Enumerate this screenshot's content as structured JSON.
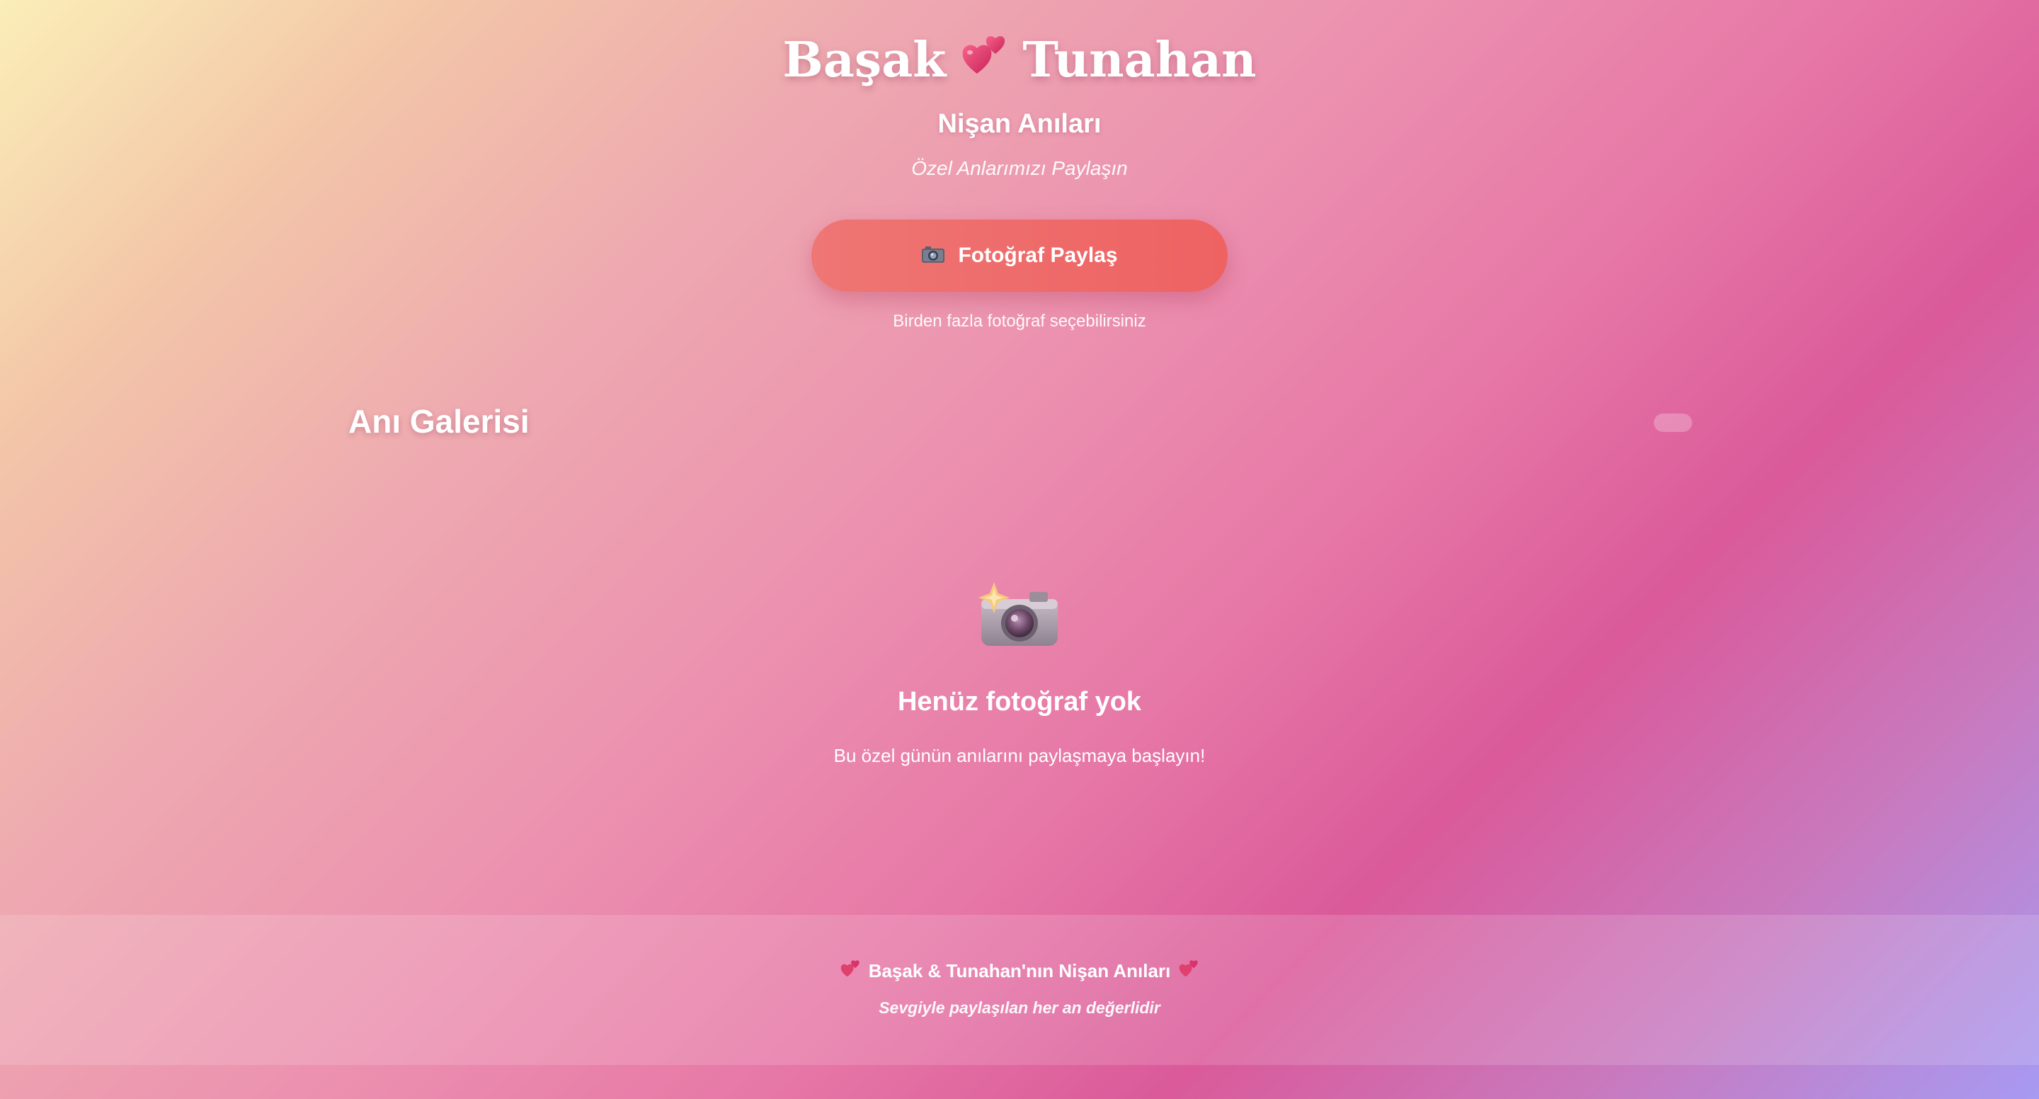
{
  "header": {
    "name_left": "Başak",
    "name_right": "Tunahan",
    "heart_icon": "two-hearts-icon",
    "subtitle": "Nişan Anıları",
    "tagline": "Özel Anlarımızı Paylaşın"
  },
  "upload": {
    "button_label": "Fotoğraf Paylaş",
    "button_icon": "camera-icon",
    "hint": "Birden fazla fotoğraf seçebilirsiniz"
  },
  "gallery": {
    "title": "Anı Galerisi",
    "empty_icon": "camera-with-flash-icon",
    "empty_title": "Henüz fotoğraf yok",
    "empty_description": "Bu özel günün anılarını paylaşmaya başlayın!"
  },
  "footer": {
    "main_text": "Başak & Tunahan'nın Nişan Anıları",
    "sub_text": "Sevgiyle paylaşılan her an değerlidir",
    "heart_icon": "two-hearts-icon"
  },
  "colors": {
    "button": "#ee6a6a",
    "heart": "#e0406e",
    "text": "#ffffff"
  }
}
